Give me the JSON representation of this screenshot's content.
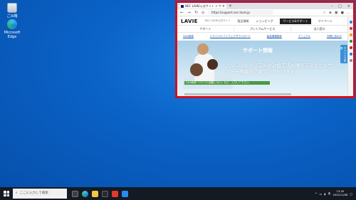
{
  "desktop": {
    "icons": [
      {
        "label": "ごみ箱",
        "icon": "recycle-bin-icon"
      },
      {
        "label": "Microsoft Edge",
        "icon": "edge-icon"
      }
    ]
  },
  "browser": {
    "tab_title": "NEC LAVIE公式サイト > サービス&...",
    "tab_close": "×",
    "new_tab": "+",
    "url": "https://support.nec-lavie.jp",
    "window_buttons": [
      "–",
      "□",
      "×"
    ],
    "colors": {
      "highlight_border": "#d20f1d"
    }
  },
  "site": {
    "logo": "LAVIE",
    "tagline": "NEC LAVIE公式サイト",
    "nav_links": [
      "製品情報",
      "ショッピング"
    ],
    "support_button": "サービス&サポート",
    "mypage": "マイページ",
    "main_nav": [
      "サポート",
      "プレミアムサービス",
      "法人窓口"
    ],
    "sub_links": [
      "Q&A検索",
      "ドライバ/ソフトウェアダウンロード",
      "製品情報検索",
      "マニュアル",
      "お問い合わせ"
    ],
    "hero_title": "サポート情報",
    "hero_text": "パソコンのトラブルの対処方法や操作方法などのサポート情報をご確認いただけます。",
    "help_tab": "チャットで質問",
    "qa_bar": "Q&A検索「パソコン起動しない」など、入力して下さい。"
  },
  "taskbar": {
    "search_placeholder": "ここに入力して検索",
    "time": "13:30",
    "date": "2022/11/08",
    "ime": "あ"
  }
}
